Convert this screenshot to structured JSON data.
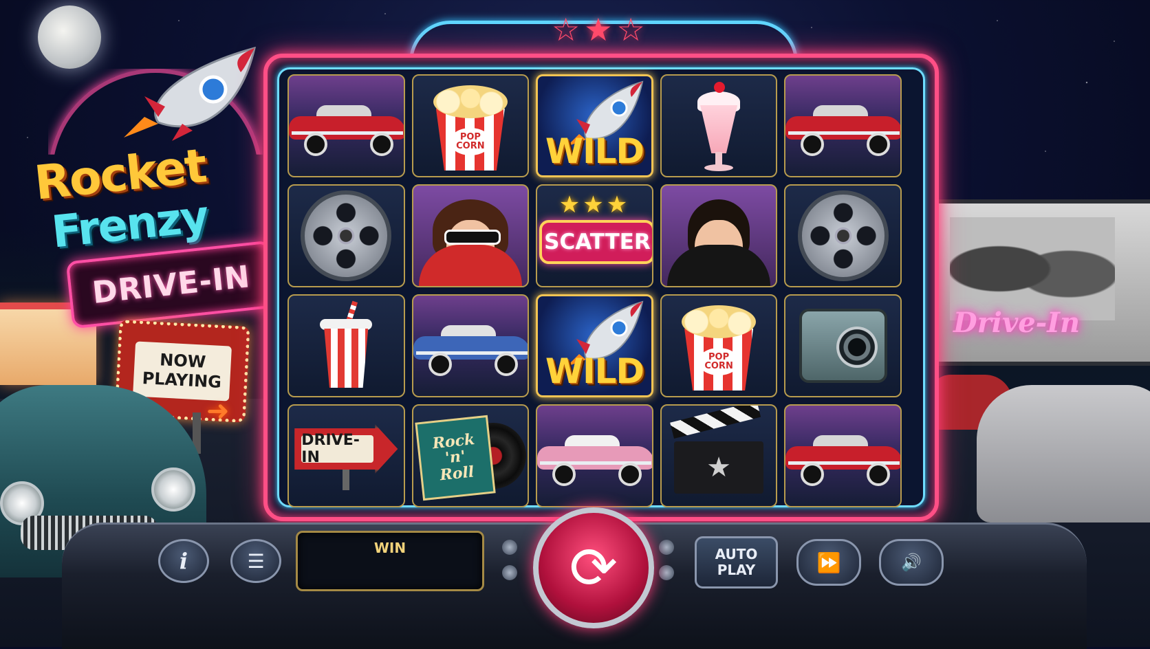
{
  "game": {
    "logo_line1": "Rocket",
    "logo_line2": "Frenzy",
    "logo_badge": "DRIVE-IN"
  },
  "scenery": {
    "now_playing_line1": "NOW",
    "now_playing_line2": "PLAYING",
    "screen_sign": "Drive-In"
  },
  "reels": [
    [
      {
        "symbol": "red-convertible-car",
        "car_color": "#c81f2b"
      },
      {
        "symbol": "popcorn",
        "label": "POP CORN"
      },
      {
        "symbol": "rocket-wild",
        "label": "WILD"
      },
      {
        "symbol": "milkshake"
      },
      {
        "symbol": "red-convertible-car",
        "car_color": "#c81f2b"
      }
    ],
    [
      {
        "symbol": "film-reel"
      },
      {
        "symbol": "pinup-girl"
      },
      {
        "symbol": "scatter",
        "label": "SCATTER"
      },
      {
        "symbol": "greaser-guy"
      },
      {
        "symbol": "film-reel"
      }
    ],
    [
      {
        "symbol": "soda-cup"
      },
      {
        "symbol": "blue-convertible-car",
        "car_color": "#3d66b8"
      },
      {
        "symbol": "rocket-wild",
        "label": "WILD"
      },
      {
        "symbol": "popcorn",
        "label": "POP CORN"
      },
      {
        "symbol": "vintage-camera"
      }
    ],
    [
      {
        "symbol": "drive-in-sign",
        "label": "DRIVE-IN"
      },
      {
        "symbol": "rock-n-roll-record",
        "label_line1": "Rock",
        "label_line2": "'n'",
        "label_line3": "Roll"
      },
      {
        "symbol": "pink-convertible-car",
        "car_color": "#e79ab8"
      },
      {
        "symbol": "clapperboard"
      },
      {
        "symbol": "red-convertible-car",
        "car_color": "#c81f2b"
      }
    ]
  ],
  "controls": {
    "info_icon": "i",
    "menu_icon": "☰",
    "win_label": "WIN",
    "win_value": "",
    "spin_icon": "⟳",
    "autoplay_line1": "AUTO",
    "autoplay_line2": "PLAY",
    "turbo_icon": "⏩",
    "sound_icon": "🔊"
  }
}
